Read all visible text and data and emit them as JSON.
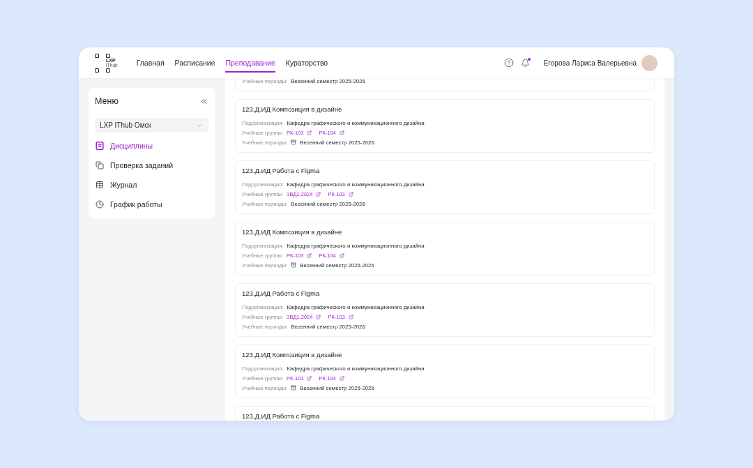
{
  "header": {
    "logo": {
      "line_1": "LXP",
      "line_2": "IThub"
    },
    "nav": [
      {
        "label": "Главная",
        "selected": false
      },
      {
        "label": "Расписание",
        "selected": false
      },
      {
        "label": "Преподавание",
        "selected": true
      },
      {
        "label": "Кураторство",
        "selected": false
      }
    ],
    "notifications": {
      "unread": true
    },
    "user": {
      "name": "Егорова Лариса Валерьевна"
    }
  },
  "sidebar": {
    "title": "Меню",
    "organization": {
      "value": "LXP IThub Омск"
    },
    "items": [
      {
        "label": "Дисциплины",
        "selected": true
      },
      {
        "label": "Проверка заданий",
        "selected": false
      },
      {
        "label": "Журнал",
        "selected": false
      },
      {
        "label": "График работы",
        "selected": false
      }
    ]
  },
  "courses": [
    {
      "periods": {
        "label": "Учебные периоды:",
        "value": "Весенний семестр 2025-2026",
        "archived": false
      }
    },
    {
      "title": "123.Д.ИД Композиция в дизайне",
      "organization": {
        "label": "Подорганизация:",
        "value": "Кафедра графического и коммуникационного дизайна"
      },
      "groups": {
        "label": "Учебные группы:",
        "items": [
          "РК-103",
          "РК-104"
        ]
      },
      "periods": {
        "label": "Учебные периоды:",
        "value": "Весенний семестр 2025-2026",
        "archived": true
      }
    },
    {
      "title": "123.Д.ИД Работа с Figma",
      "organization": {
        "label": "Подорганизация:",
        "value": "Кафедра графического и коммуникационного дизайна"
      },
      "groups": {
        "label": "Учебные группы:",
        "items": [
          "ЗВД1.2024",
          "РК-103"
        ]
      },
      "periods": {
        "label": "Учебные периоды:",
        "value": "Весенний семестр 2025-2026",
        "archived": false
      }
    },
    {
      "title": "123.Д.ИД Композиция в дизайне",
      "organization": {
        "label": "Подорганизация:",
        "value": "Кафедра графического и коммуникационного дизайна"
      },
      "groups": {
        "label": "Учебные группы:",
        "items": [
          "РК-103",
          "РК-104"
        ]
      },
      "periods": {
        "label": "Учебные периоды:",
        "value": "Весенний семестр 2025-2026",
        "archived": true
      }
    },
    {
      "title": "123.Д.ИД Работа с Figma",
      "organization": {
        "label": "Подорганизация:",
        "value": "Кафедра графического и коммуникационного дизайна"
      },
      "groups": {
        "label": "Учебные группы:",
        "items": [
          "ЗВД1.2024",
          "РК-103"
        ]
      },
      "periods": {
        "label": "Учебные периоды:",
        "value": "Весенний семестр 2025-2026",
        "archived": false
      }
    },
    {
      "title": "123.Д.ИД Композиция в дизайне",
      "organization": {
        "label": "Подорганизация:",
        "value": "Кафедра графического и коммуникационного дизайна"
      },
      "groups": {
        "label": "Учебные группы:",
        "items": [
          "РК-103",
          "РК-104"
        ]
      },
      "periods": {
        "label": "Учебные периоды:",
        "value": "Весенний семестр 2025-2026",
        "archived": true
      }
    },
    {
      "title": "123.Д.ИД Работа с Figma"
    }
  ]
}
